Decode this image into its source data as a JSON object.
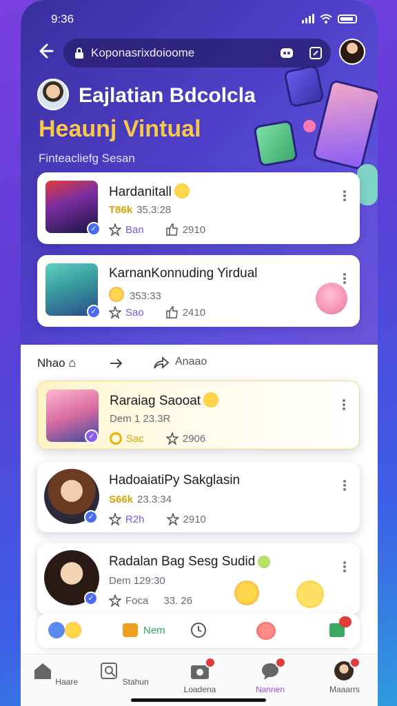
{
  "status": {
    "time": "9:36"
  },
  "browser": {
    "url": "Koponasrixdoioome"
  },
  "hero": {
    "title": "Eajlatian Bdcolcla",
    "headline": "Heaunj Vintual",
    "subtitle": "Finteacliefg Sesan"
  },
  "featured": [
    {
      "title": "Hardanitall",
      "meta_highlight": "T86k",
      "meta": "35.3:28",
      "rating": "Ban",
      "count": "2910"
    },
    {
      "title": "KarnanKonnuding Yirdual",
      "meta": "353:33",
      "rating": "Sao",
      "count": "2410"
    }
  ],
  "feed_tabs": {
    "first": "Nhao",
    "third": "Anaao"
  },
  "feed": [
    {
      "title": "Raraiag Saooat",
      "meta": "Dem 1 23.3R",
      "rating": "Sac",
      "count": "2906"
    },
    {
      "title": "HadoaiatiPy Sakglasin",
      "meta_highlight": "S66k",
      "meta": "23.3:34",
      "rating": "R2h",
      "count": "2910"
    },
    {
      "title": "Radalan Bag Sesg Sudid",
      "meta": "Dem 129:30",
      "rating": "Foca",
      "count": "33. 26"
    }
  ],
  "action_bar": {
    "middle_label": "Nem"
  },
  "nav": [
    {
      "label": "Haare"
    },
    {
      "label": "Stahun"
    },
    {
      "label": "Loadena"
    },
    {
      "label": "Nannen"
    },
    {
      "label": "Maaarrs"
    }
  ],
  "colors": {
    "accent": "#9b4fd8",
    "headline": "#f7c84a",
    "verified": "#4a6cf0",
    "notification": "#e23b3b"
  }
}
